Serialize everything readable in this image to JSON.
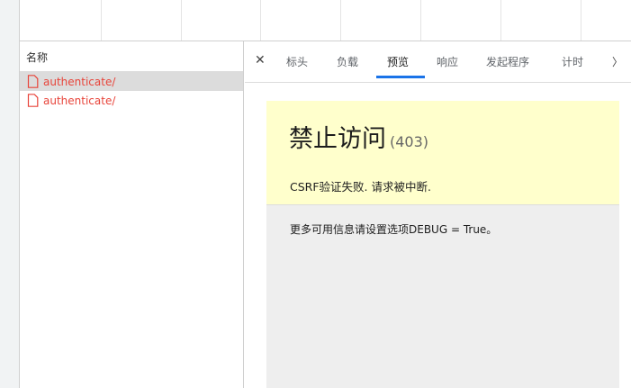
{
  "request_list": {
    "header": "名称",
    "rows": [
      {
        "name": "authenticate/",
        "selected": true
      },
      {
        "name": "authenticate/",
        "selected": false
      }
    ],
    "error_color": "#e8443a"
  },
  "details": {
    "tabs": [
      "标头",
      "负载",
      "预览",
      "响应",
      "发起程序",
      "计时"
    ],
    "active_tab": "预览",
    "accent_color": "#1a73e8"
  },
  "preview": {
    "title": "禁止访问",
    "status_code": "(403)",
    "reason": "CSRF验证失败. 请求被中断.",
    "info": "更多可用信息请设置选项DEBUG = True。"
  }
}
